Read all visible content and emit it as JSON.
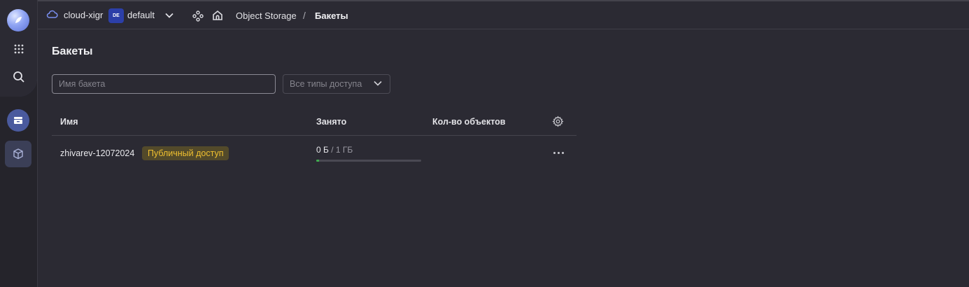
{
  "header": {
    "cloud_name": "cloud-xigr",
    "folder_badge": "DE",
    "folder_name": "default",
    "breadcrumbs": [
      "Object Storage",
      "Бакеты"
    ],
    "separator": "/"
  },
  "page": {
    "title": "Бакеты"
  },
  "filters": {
    "search_placeholder": "Имя бакета",
    "search_value": "",
    "access_select": "Все типы доступа"
  },
  "table": {
    "columns": [
      "Имя",
      "Занято",
      "Кол-во объектов"
    ],
    "rows": [
      {
        "name": "zhivarev-12072024",
        "access_badge": "Публичный доступ",
        "used": "0 Б",
        "total": "/ 1 ГБ",
        "usage_fraction": 0.01,
        "objects": ""
      }
    ]
  },
  "colors": {
    "accent": "#4a5a9e",
    "badge_text": "#f0c030",
    "badge_bg": "#534a2a",
    "progress": "#3fae4f"
  },
  "icons": [
    "logo-icon",
    "apps-grid-icon",
    "search-icon",
    "storage-icon",
    "cube-icon",
    "cloud-icon",
    "chevron-down-icon",
    "graph-icon",
    "home-icon",
    "gear-icon",
    "more-icon"
  ]
}
